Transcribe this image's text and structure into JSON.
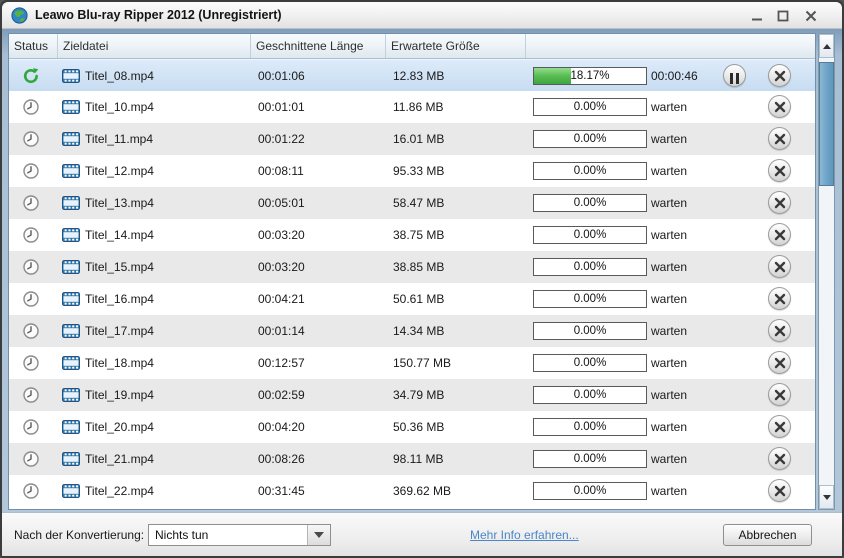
{
  "titlebar": {
    "title": "Leawo Blu-ray Ripper 2012 (Unregistriert)"
  },
  "icons": {
    "app": "globe",
    "minimize": "minimize-line",
    "maximize": "maximize-square",
    "close": "close-x",
    "status_converting": "green-refresh-arrow",
    "status_waiting": "clock",
    "file_type": "filmstrip",
    "pause": "pause-bars",
    "remove": "circle-x",
    "dropdown_arrow": "triangle-down",
    "scroll_up": "triangle-up",
    "scroll_down": "triangle-down"
  },
  "colors": {
    "selected_row": "#cfe1f3",
    "row_alt": "#e9e9e9",
    "progress_fill_green": "#4db34d",
    "scrollbar_thumb": "#6ea5c8",
    "link_blue": "#4a86c8",
    "film_icon_blue": "#2d74ad",
    "status_green": "#2fa83c"
  },
  "table": {
    "columns": [
      "Status",
      "Zieldatei",
      "Geschnittene Länge",
      "Erwartete Größe",
      ""
    ],
    "rows": [
      {
        "status": "converting",
        "selected": true,
        "file": "Titel_08.mp4",
        "cut_length": "00:01:06",
        "expected_size": "12.83 MB",
        "progress_label": "18.17%",
        "progress_percent": 18.17,
        "progress_fill_percent": 33,
        "state_text": "00:00:46"
      },
      {
        "status": "waiting",
        "file": "Titel_10.mp4",
        "cut_length": "00:01:01",
        "expected_size": "11.86 MB",
        "progress_label": "0.00%",
        "progress_percent": 0,
        "state_text": "warten"
      },
      {
        "status": "waiting",
        "file": "Titel_11.mp4",
        "cut_length": "00:01:22",
        "expected_size": "16.01 MB",
        "progress_label": "0.00%",
        "progress_percent": 0,
        "state_text": "warten"
      },
      {
        "status": "waiting",
        "file": "Titel_12.mp4",
        "cut_length": "00:08:11",
        "expected_size": "95.33 MB",
        "progress_label": "0.00%",
        "progress_percent": 0,
        "state_text": "warten"
      },
      {
        "status": "waiting",
        "file": "Titel_13.mp4",
        "cut_length": "00:05:01",
        "expected_size": "58.47 MB",
        "progress_label": "0.00%",
        "progress_percent": 0,
        "state_text": "warten"
      },
      {
        "status": "waiting",
        "file": "Titel_14.mp4",
        "cut_length": "00:03:20",
        "expected_size": "38.75 MB",
        "progress_label": "0.00%",
        "progress_percent": 0,
        "state_text": "warten"
      },
      {
        "status": "waiting",
        "file": "Titel_15.mp4",
        "cut_length": "00:03:20",
        "expected_size": "38.85 MB",
        "progress_label": "0.00%",
        "progress_percent": 0,
        "state_text": "warten"
      },
      {
        "status": "waiting",
        "file": "Titel_16.mp4",
        "cut_length": "00:04:21",
        "expected_size": "50.61 MB",
        "progress_label": "0.00%",
        "progress_percent": 0,
        "state_text": "warten"
      },
      {
        "status": "waiting",
        "file": "Titel_17.mp4",
        "cut_length": "00:01:14",
        "expected_size": "14.34 MB",
        "progress_label": "0.00%",
        "progress_percent": 0,
        "state_text": "warten"
      },
      {
        "status": "waiting",
        "file": "Titel_18.mp4",
        "cut_length": "00:12:57",
        "expected_size": "150.77 MB",
        "progress_label": "0.00%",
        "progress_percent": 0,
        "state_text": "warten"
      },
      {
        "status": "waiting",
        "file": "Titel_19.mp4",
        "cut_length": "00:02:59",
        "expected_size": "34.79 MB",
        "progress_label": "0.00%",
        "progress_percent": 0,
        "state_text": "warten"
      },
      {
        "status": "waiting",
        "file": "Titel_20.mp4",
        "cut_length": "00:04:20",
        "expected_size": "50.36 MB",
        "progress_label": "0.00%",
        "progress_percent": 0,
        "state_text": "warten"
      },
      {
        "status": "waiting",
        "file": "Titel_21.mp4",
        "cut_length": "00:08:26",
        "expected_size": "98.11 MB",
        "progress_label": "0.00%",
        "progress_percent": 0,
        "state_text": "warten"
      },
      {
        "status": "waiting",
        "file": "Titel_22.mp4",
        "cut_length": "00:31:45",
        "expected_size": "369.62 MB",
        "progress_label": "0.00%",
        "progress_percent": 0,
        "state_text": "warten"
      }
    ]
  },
  "footer": {
    "after_conversion_label": "Nach der Konvertierung:",
    "after_conversion_value": "Nichts tun",
    "more_info_link": "Mehr Info erfahren...",
    "cancel_button": "Abbrechen"
  }
}
